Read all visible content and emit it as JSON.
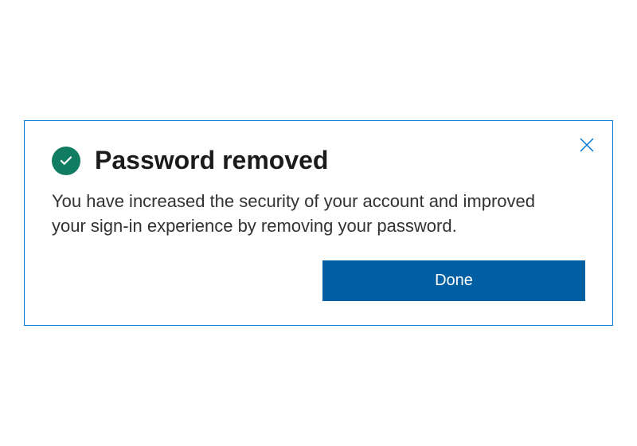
{
  "dialog": {
    "title": "Password removed",
    "message": "You have increased the security of your account and improved your sign-in experience by removing your password.",
    "done_label": "Done"
  },
  "colors": {
    "accent": "#005fa3",
    "border": "#0078d4",
    "success": "#107c61"
  }
}
